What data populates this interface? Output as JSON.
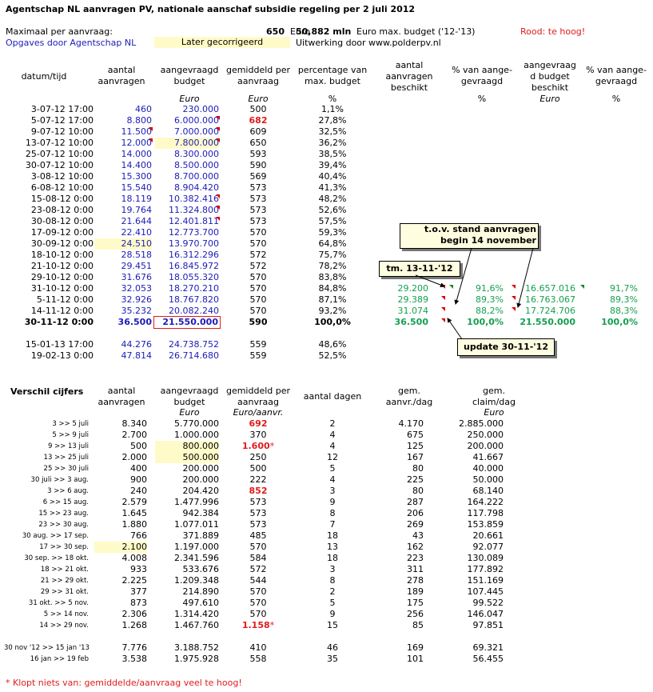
{
  "header": {
    "title": "Agentschap NL aanvragen PV, nationale aanschaf subsidie regeling per 2 juli 2012",
    "max_label": "Maximaal per aanvraag:",
    "max_value": "650",
    "max_unit": "Euro",
    "budget_value": "50,882 mln",
    "budget_text": "Euro max. budget ('12-'13)",
    "rood": "Rood: te hoog!",
    "opgaves": "Opgaves door Agentschap NL",
    "later": "Later gecorrigeerd",
    "uitwerking": "Uitwerking door www.polderpv.nl"
  },
  "top_headers": {
    "datum": "datum/tijd",
    "aantal1": "aantal",
    "aantal2": "aanvragen",
    "aangevraagd1": "aangevraagd",
    "aangevraagd2": "budget",
    "gemiddeld1": "gemiddeld per",
    "gemiddeld2": "aanvraag",
    "percentage1": "percentage van",
    "percentage2": "max. budget",
    "beschikt1": "aantal",
    "beschikt2": "aanvragen",
    "beschikt3": "beschikt",
    "pct_aan1": "% van aange-",
    "pct_aan2": "gevraagd",
    "budget_besch1": "aangevraag",
    "budget_besch2": "d budget",
    "budget_besch3": "beschikt",
    "pct_aan_b1": "% van aange-",
    "pct_aan_b2": "gevraagd",
    "unit_euro": "Euro",
    "unit_pct": "%"
  },
  "top_rows": [
    {
      "d": "3-07-12 17:00",
      "n": "460",
      "b": "230.000",
      "g": "500",
      "p": "1,1%"
    },
    {
      "d": "5-07-12 17:00",
      "n": "8.800",
      "b": "6.000.000",
      "g": "682",
      "p": "27,8%"
    },
    {
      "d": "9-07-12 10:00",
      "n": "11.500",
      "b": "7.000.000",
      "g": "609",
      "p": "32,5%"
    },
    {
      "d": "13-07-12 10:00",
      "n": "12.000",
      "b": "7.800.000",
      "g": "650",
      "p": "36,2%"
    },
    {
      "d": "25-07-12 10:00",
      "n": "14.000",
      "b": "8.300.000",
      "g": "593",
      "p": "38,5%"
    },
    {
      "d": "30-07-12 10:00",
      "n": "14.400",
      "b": "8.500.000",
      "g": "590",
      "p": "39,4%"
    },
    {
      "d": "3-08-12 10:00",
      "n": "15.300",
      "b": "8.700.000",
      "g": "569",
      "p": "40,4%"
    },
    {
      "d": "6-08-12 10:00",
      "n": "15.540",
      "b": "8.904.420",
      "g": "573",
      "p": "41,3%"
    },
    {
      "d": "15-08-12 0:00",
      "n": "18.119",
      "b": "10.382.416",
      "g": "573",
      "p": "48,2%"
    },
    {
      "d": "23-08-12 0:00",
      "n": "19.764",
      "b": "11.324.800",
      "g": "573",
      "p": "52,6%"
    },
    {
      "d": "30-08-12 0:00",
      "n": "21.644",
      "b": "12.401.811",
      "g": "573",
      "p": "57,5%"
    },
    {
      "d": "17-09-12 0:00",
      "n": "22.410",
      "b": "12.773.700",
      "g": "570",
      "p": "59,3%"
    },
    {
      "d": "30-09-12 0:00",
      "n": "24.510",
      "b": "13.970.700",
      "g": "570",
      "p": "64,8%"
    },
    {
      "d": "18-10-12 0:00",
      "n": "28.518",
      "b": "16.312.296",
      "g": "572",
      "p": "75,7%"
    },
    {
      "d": "21-10-12 0:00",
      "n": "29.451",
      "b": "16.845.972",
      "g": "572",
      "p": "78,2%"
    },
    {
      "d": "29-10-12 0:00",
      "n": "31.676",
      "b": "18.055.320",
      "g": "570",
      "p": "83,8%"
    },
    {
      "d": "31-10-12 0:00",
      "n": "32.053",
      "b": "18.270.210",
      "g": "570",
      "p": "84,8%",
      "bn": "29.200",
      "bp": "91,6%",
      "bb": "16.657.016",
      "bbp": "91,7%"
    },
    {
      "d": "5-11-12 0:00",
      "n": "32.926",
      "b": "18.767.820",
      "g": "570",
      "p": "87,1%",
      "bn": "29.389",
      "bp": "89,3%",
      "bb": "16.763.067",
      "bbp": "89,3%"
    },
    {
      "d": "14-11-12 0:00",
      "n": "35.232",
      "b": "20.082.240",
      "g": "570",
      "p": "93,2%",
      "bn": "31.074",
      "bp": "88,2%",
      "bb": "17.724.706",
      "bbp": "88,3%"
    },
    {
      "d": "30-11-12 0:00",
      "n": "36.500",
      "b": "21.550.000",
      "g": "590",
      "p": "100,0%",
      "bn": "36.500",
      "bp": "100,0%",
      "bb": "21.550.000",
      "bbp": "100,0%"
    },
    {
      "d": "15-01-13 17:00",
      "n": "44.276",
      "b": "24.738.752",
      "g": "559",
      "p": "48,6%"
    },
    {
      "d": "19-02-13 0:00",
      "n": "47.814",
      "b": "26.714.680",
      "g": "559",
      "p": "52,5%"
    }
  ],
  "callouts": {
    "tov1": "t.o.v. stand aanvragen",
    "tov2": "begin 14 november",
    "tm": "tm. 13-11-'12",
    "update": "update 30-11-'12"
  },
  "bottom_headers": {
    "title": "Verschil cijfers",
    "aantal1": "aantal",
    "aantal2": "aanvragen",
    "aangevraagd1": "aangevraagd",
    "aangevraagd2": "budget",
    "aangevraagd3": "Euro",
    "gemiddeld1": "gemiddeld per",
    "gemiddeld2": "aanvraag",
    "gemiddeld3": "Euro/aanvr.",
    "dagen": "aantal dagen",
    "gemaanvr1": "gem.",
    "gemaanvr2": "aanvr./dag",
    "gemclaim1": "gem.",
    "gemclaim2": "claim/dag",
    "gemclaim3": "Euro"
  },
  "bottom_rows": [
    {
      "l": "3 >> 5 juli",
      "n": "8.340",
      "b": "5.770.000",
      "g": "692",
      "dg": "2",
      "ad": "4.170",
      "cd": "2.885.000"
    },
    {
      "l": "5 >> 9 juli",
      "n": "2.700",
      "b": "1.000.000",
      "g": "370",
      "dg": "4",
      "ad": "675",
      "cd": "250.000"
    },
    {
      "l": "9 >> 13 juli",
      "n": "500",
      "b": "800.000",
      "g": "1.600",
      "dg": "4",
      "ad": "125",
      "cd": "200.000"
    },
    {
      "l": "13 >> 25 juli",
      "n": "2.000",
      "b": "500.000",
      "g": "250",
      "dg": "12",
      "ad": "167",
      "cd": "41.667"
    },
    {
      "l": "25 >> 30 juli",
      "n": "400",
      "b": "200.000",
      "g": "500",
      "dg": "5",
      "ad": "80",
      "cd": "40.000"
    },
    {
      "l": "30 juli >> 3 aug.",
      "n": "900",
      "b": "200.000",
      "g": "222",
      "dg": "4",
      "ad": "225",
      "cd": "50.000"
    },
    {
      "l": "3 >> 6 aug.",
      "n": "240",
      "b": "204.420",
      "g": "852",
      "dg": "3",
      "ad": "80",
      "cd": "68.140"
    },
    {
      "l": "6 >> 15 aug.",
      "n": "2.579",
      "b": "1.477.996",
      "g": "573",
      "dg": "9",
      "ad": "287",
      "cd": "164.222"
    },
    {
      "l": "15 >> 23 aug.",
      "n": "1.645",
      "b": "942.384",
      "g": "573",
      "dg": "8",
      "ad": "206",
      "cd": "117.798"
    },
    {
      "l": "23 >> 30 aug.",
      "n": "1.880",
      "b": "1.077.011",
      "g": "573",
      "dg": "7",
      "ad": "269",
      "cd": "153.859"
    },
    {
      "l": "30 aug. >> 17 sep.",
      "n": "766",
      "b": "371.889",
      "g": "485",
      "dg": "18",
      "ad": "43",
      "cd": "20.661"
    },
    {
      "l": "17 >> 30 sep.",
      "n": "2.100",
      "b": "1.197.000",
      "g": "570",
      "dg": "13",
      "ad": "162",
      "cd": "92.077"
    },
    {
      "l": "30 sep. >> 18 okt.",
      "n": "4.008",
      "b": "2.341.596",
      "g": "584",
      "dg": "18",
      "ad": "223",
      "cd": "130.089"
    },
    {
      "l": "18 >> 21 okt.",
      "n": "933",
      "b": "533.676",
      "g": "572",
      "dg": "3",
      "ad": "311",
      "cd": "177.892"
    },
    {
      "l": "21 >> 29 okt.",
      "n": "2.225",
      "b": "1.209.348",
      "g": "544",
      "dg": "8",
      "ad": "278",
      "cd": "151.169"
    },
    {
      "l": "29 >> 31 okt.",
      "n": "377",
      "b": "214.890",
      "g": "570",
      "dg": "2",
      "ad": "189",
      "cd": "107.445"
    },
    {
      "l": "31 okt. >> 5 nov.",
      "n": "873",
      "b": "497.610",
      "g": "570",
      "dg": "5",
      "ad": "175",
      "cd": "99.522"
    },
    {
      "l": "5 >> 14 nov.",
      "n": "2.306",
      "b": "1.314.420",
      "g": "570",
      "dg": "9",
      "ad": "256",
      "cd": "146.047"
    },
    {
      "l": "14 >> 29 nov.",
      "n": "1.268",
      "b": "1.467.760",
      "g": "1.158",
      "dg": "15",
      "ad": "85",
      "cd": "97.851"
    },
    {
      "l": "30 nov '12 >> 15 jan '13",
      "n": "7.776",
      "b": "3.188.752",
      "g": "410",
      "dg": "46",
      "ad": "169",
      "cd": "69.321"
    },
    {
      "l": "16 jan >> 19 feb",
      "n": "3.538",
      "b": "1.975.928",
      "g": "558",
      "dg": "35",
      "ad": "101",
      "cd": "56.455"
    }
  ],
  "star": "*",
  "footnote": "* Klopt niets van: gemiddelde/aanvraag veel te hoog!",
  "colors": {
    "blue": "#1c1cb8",
    "green": "#14a050",
    "red": "#e01c1c",
    "highlight": "#fffbc8"
  }
}
